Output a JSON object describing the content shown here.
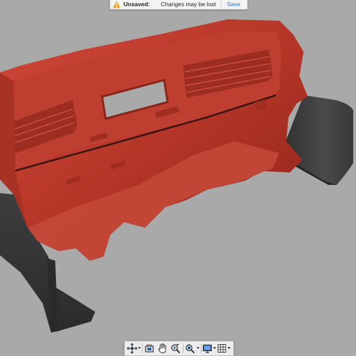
{
  "banner": {
    "icon": "warning-icon",
    "status_label": "Unsaved:",
    "message": "Changes may be lost",
    "save_label": "Save",
    "accent": "#1e6fc9",
    "warning_color": "#f0a020"
  },
  "viewport": {
    "background": "#a9a9a9",
    "model_color": "#b93a2c",
    "panel_color": "#3c3c3c"
  },
  "toolbar": {
    "tools": [
      "orbit-icon",
      "look-at-icon",
      "pan-hand-icon",
      "zoom-window-icon",
      "fit-zoom-icon",
      "display-settings-icon",
      "grid-settings-icon"
    ]
  }
}
